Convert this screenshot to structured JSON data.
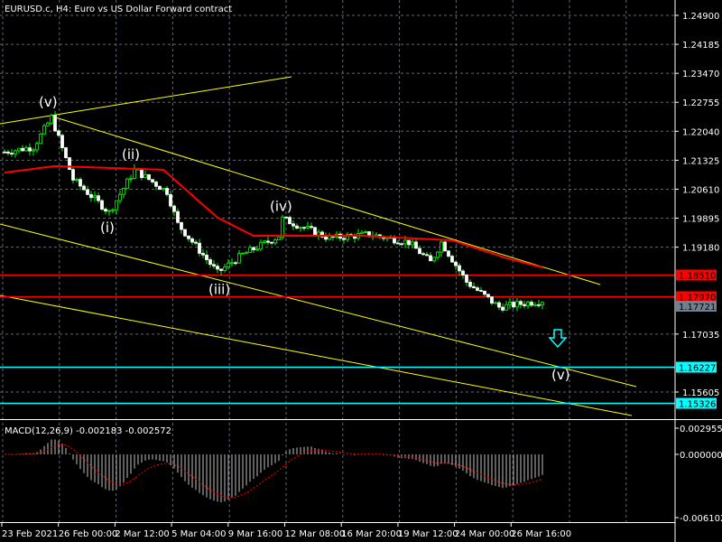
{
  "title": "EURUSD.c, H4:  Euro vs US Dollar Forward contract",
  "colors": {
    "bg": "#000000",
    "up": "#00ff00",
    "candle": "#ffffff",
    "ma": "#ff0000",
    "channel": "#ffff00",
    "cyan": "#00ffff",
    "red": "#ff0000",
    "gray": "#708090",
    "grid": "#606875"
  },
  "chart_data": {
    "type": "candlestick",
    "symbol": "EURUSD.c",
    "timeframe": "H4",
    "price_ticks": [
      "1.24900",
      "1.24185",
      "1.23470",
      "1.22755",
      "1.22040",
      "1.21325",
      "1.20610",
      "1.19895",
      "1.19180",
      "1.17035",
      "1.15605"
    ],
    "price_ticks_values": [
      1.249,
      1.24185,
      1.2347,
      1.22755,
      1.2204,
      1.21325,
      1.2061,
      1.19895,
      1.1918,
      1.17035,
      1.15605
    ],
    "ylim": [
      1.1455,
      1.2528
    ],
    "time_ticks": [
      "23 Feb 2021",
      "26 Feb 00:00",
      "2 Mar 12:00",
      "5 Mar 04:00",
      "9 Mar 16:00",
      "12 Mar 08:00",
      "16 Mar 20:00",
      "19 Mar 12:00",
      "24 Mar 00:00",
      "26 Mar 16:00"
    ],
    "price_path": [
      [
        0,
        1.2153
      ],
      [
        8,
        1.2165
      ],
      [
        13,
        1.2238
      ],
      [
        19,
        1.2085
      ],
      [
        29,
        1.2004
      ],
      [
        36,
        1.2109
      ],
      [
        45,
        1.2055
      ],
      [
        48,
        1.1975
      ],
      [
        59,
        1.1855
      ],
      [
        66,
        1.19
      ],
      [
        76,
        1.1945
      ],
      [
        77,
        1.1988
      ],
      [
        90,
        1.194
      ],
      [
        101,
        1.195
      ],
      [
        112,
        1.193
      ],
      [
        118,
        1.1881
      ],
      [
        121,
        1.193
      ],
      [
        128,
        1.1832
      ],
      [
        137,
        1.177
      ],
      [
        149,
        1.1786
      ]
    ],
    "moving_average_path": [
      [
        0,
        1.2102
      ],
      [
        14,
        1.2118
      ],
      [
        44,
        1.2109
      ],
      [
        59,
        1.1991
      ],
      [
        69,
        1.1946
      ],
      [
        99,
        1.1946
      ],
      [
        124,
        1.1935
      ],
      [
        139,
        1.1891
      ],
      [
        149,
        1.1868
      ]
    ],
    "levels": [
      {
        "label": "1.18510",
        "price": 1.1851,
        "color": "#ff0000"
      },
      {
        "label": "1.17970",
        "price": 1.1797,
        "color": "#ff0000"
      },
      {
        "label": "1.16227",
        "price": 1.16227,
        "color": "#00ffff"
      },
      {
        "label": "1.15326",
        "price": 1.15326,
        "color": "#00ffff"
      }
    ],
    "bid_label": "1.17721",
    "wave_labels": [
      {
        "text": "(v)",
        "bar": 12,
        "price": 1.2276
      },
      {
        "text": "(ii)",
        "bar": 35,
        "price": 1.2147
      },
      {
        "text": "(i)",
        "bar": 29,
        "price": 1.1966
      },
      {
        "text": "(iv)",
        "bar": 76,
        "price": 1.2018
      },
      {
        "text": "(iii)",
        "bar": 59,
        "price": 1.1813
      },
      {
        "text": "(v)",
        "bar": 154,
        "price": 1.1603
      }
    ],
    "macd": {
      "label": "MACD(12,26,9) -0.002183 -0.002572",
      "ticks": [
        "0.002955",
        "0.000000",
        "-0.006102"
      ],
      "tick_values": [
        0.002955,
        0,
        -0.006102
      ]
    }
  }
}
